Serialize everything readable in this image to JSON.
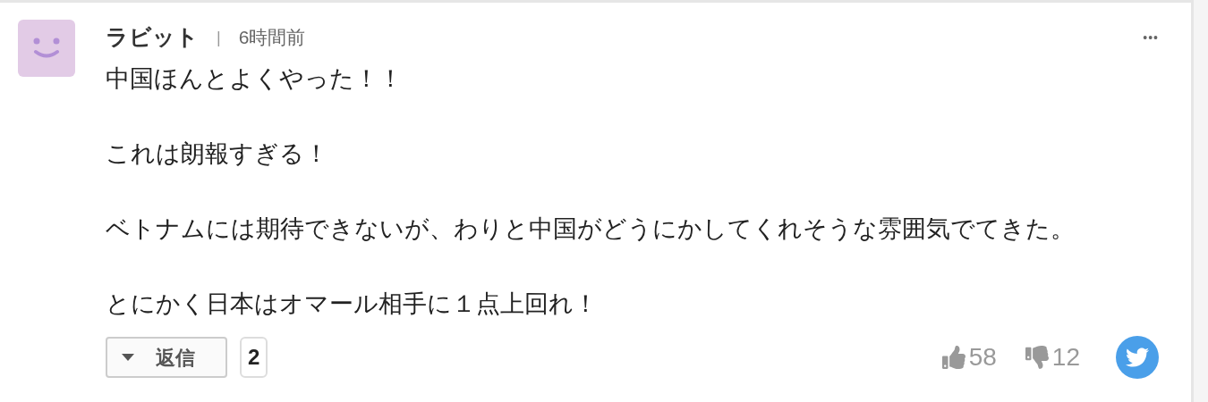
{
  "comment": {
    "author": "ラビット",
    "separator": "|",
    "time": "6時間前",
    "more": "•••",
    "paragraphs": [
      "中国ほんとよくやった！！",
      "これは朗報すぎる！",
      "ベトナムには期待できないが、わりと中国がどうにかしてくれそうな雰囲気でてきた。",
      "とにかく日本はオマール相手に１点上回れ！"
    ],
    "reply_button": "返信",
    "reply_count": "2",
    "likes": "58",
    "dislikes": "12"
  }
}
